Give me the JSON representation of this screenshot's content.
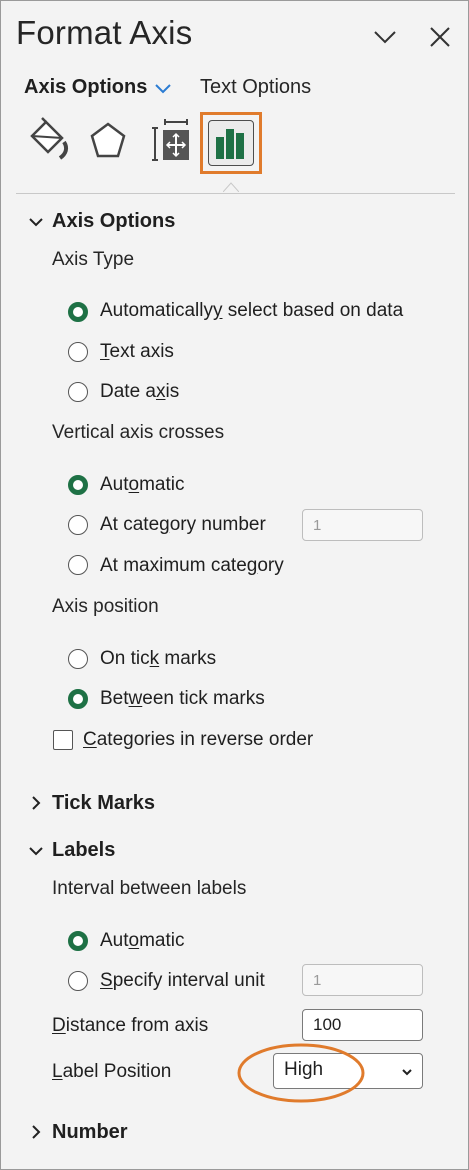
{
  "pane": {
    "title": "Format Axis",
    "collapse_icon": "chevron-down-icon",
    "close_icon": "close-icon"
  },
  "tabs": {
    "active": "Axis Options",
    "other": "Text Options",
    "accent_color": "#2b7cd3"
  },
  "category_icons": [
    "fill-line-icon",
    "effects-icon",
    "size-properties-icon",
    "axis-options-icon"
  ],
  "selected_icon_color": "#1e7145",
  "highlight_color": "#e07b2c",
  "axis_options": {
    "heading": "Axis Options",
    "axis_type": {
      "label": "Axis Type",
      "options": [
        {
          "pre": "Automatically",
          "u": "y",
          "post": " select based on data",
          "selected": true
        },
        {
          "pre": "",
          "u": "T",
          "post": "ext axis",
          "selected": false
        },
        {
          "pre": "Date a",
          "u": "x",
          "post": "is",
          "selected": false
        }
      ]
    },
    "vertical_crosses": {
      "label": "Vertical axis crosses",
      "options": [
        {
          "pre": "Aut",
          "u": "o",
          "post": "matic",
          "selected": true
        },
        {
          "pre": "At cate",
          "u": "g",
          "post": "ory number",
          "selected": false
        },
        {
          "pre": "At maximum cate",
          "u": "g",
          "post": "ory",
          "selected": false
        }
      ],
      "category_number_value": "1"
    },
    "axis_position": {
      "label": "Axis position",
      "options": [
        {
          "pre": "On tic",
          "u": "k",
          "post": " marks",
          "selected": false
        },
        {
          "pre": "Bet",
          "u": "w",
          "post": "een tick marks",
          "selected": true
        }
      ]
    },
    "reverse_order": {
      "pre": "",
      "u": "C",
      "post": "ategories in reverse order",
      "checked": false
    }
  },
  "tick_marks": {
    "heading": "Tick Marks"
  },
  "labels": {
    "heading": "Labels",
    "interval_label": "Interval between labels",
    "options": [
      {
        "pre": "Aut",
        "u": "o",
        "post": "matic",
        "selected": true
      },
      {
        "pre": "",
        "u": "S",
        "post": "pecify interval unit",
        "selected": false
      }
    ],
    "interval_unit_value": "1",
    "distance": {
      "pre": "",
      "u": "D",
      "post": "istance from axis",
      "value": "100"
    },
    "label_position": {
      "pre": "",
      "u": "L",
      "post": "abel Position",
      "value": "High"
    }
  },
  "number": {
    "heading": "Number"
  }
}
